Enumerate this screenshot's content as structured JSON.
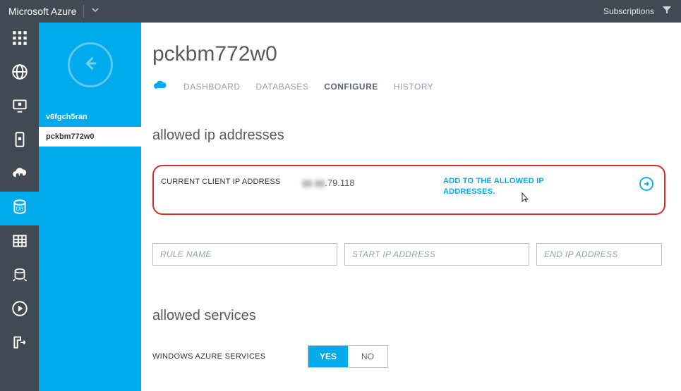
{
  "colors": {
    "accent": "#00abec",
    "rail": "#414952",
    "highlight_border": "#d92b2b"
  },
  "topbar": {
    "brand": "Microsoft Azure",
    "subscriptions_label": "Subscriptions"
  },
  "navrail": {
    "items": [
      {
        "name": "all-items",
        "icon": "apps"
      },
      {
        "name": "web",
        "icon": "globe"
      },
      {
        "name": "virtual-machines",
        "icon": "monitor-cube"
      },
      {
        "name": "mobile-services",
        "icon": "mobile-cube"
      },
      {
        "name": "cloud-services",
        "icon": "cloud-gear"
      },
      {
        "name": "sql-databases",
        "icon": "db",
        "active": true
      },
      {
        "name": "storage",
        "icon": "grid-table"
      },
      {
        "name": "hdinsight",
        "icon": "db-arrows"
      },
      {
        "name": "media-services",
        "icon": "play-circle"
      },
      {
        "name": "service-bus",
        "icon": "export"
      }
    ]
  },
  "sidepanel": {
    "items": [
      {
        "label": "v6fgch5ran",
        "selected": false
      },
      {
        "label": "pckbm772w0",
        "selected": true
      }
    ]
  },
  "page": {
    "title": "pckbm772w0",
    "tabs": [
      {
        "label": "DASHBOARD",
        "active": false
      },
      {
        "label": "DATABASES",
        "active": false
      },
      {
        "label": "CONFIGURE",
        "active": true
      },
      {
        "label": "HISTORY",
        "active": false
      }
    ]
  },
  "allowed_ip": {
    "section_title": "allowed ip addresses",
    "current_label": "CURRENT CLIENT IP ADDRESS",
    "current_ip_obscured_prefix": "▮▮.▮▮",
    "current_ip_visible_suffix": ".79.118",
    "add_link": "ADD TO THE ALLOWED IP ADDRESSES.",
    "inputs": {
      "rule_name_placeholder": "RULE NAME",
      "start_ip_placeholder": "START IP ADDRESS",
      "end_ip_placeholder": "END IP ADDRESS"
    }
  },
  "allowed_services": {
    "section_title": "allowed services",
    "row_label": "WINDOWS AZURE SERVICES",
    "toggle": {
      "yes": "YES",
      "no": "NO",
      "value": "YES"
    }
  }
}
